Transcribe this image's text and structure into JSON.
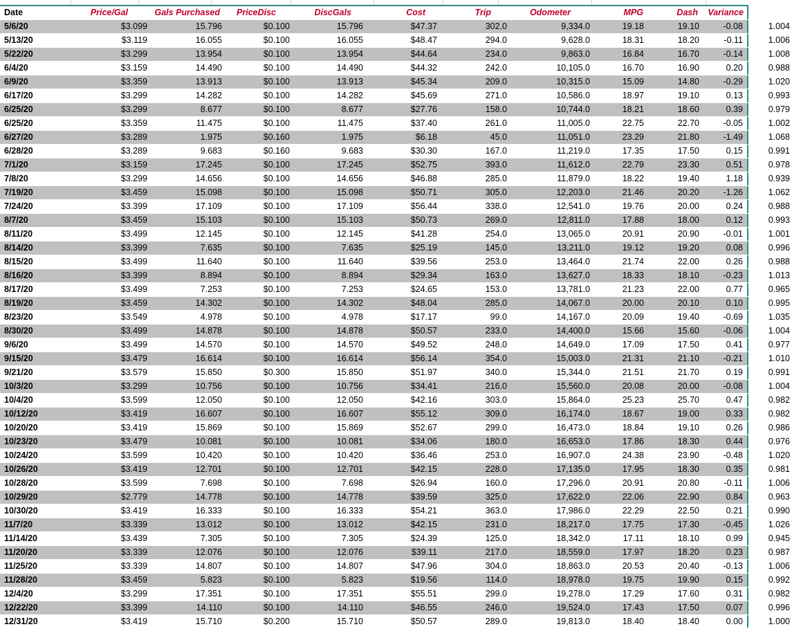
{
  "headers": {
    "date": "Date",
    "price": "Price/Gal",
    "gals": "Gals Purchased",
    "pricedisc": "PriceDisc",
    "discgals": "DiscGals",
    "cost": "Cost",
    "trip": "Trip",
    "odometer": "Odometer",
    "mpg": "MPG",
    "dash": "Dash",
    "variance": "Variance"
  },
  "rows": [
    [
      "5/6/20",
      "$3.099",
      "15.796",
      "$0.100",
      "15.796",
      "$47.37",
      "302.0",
      "9,334.0",
      "19.18",
      "19.10",
      "-0.08",
      "1.004"
    ],
    [
      "5/13/20",
      "$3.119",
      "16.055",
      "$0.100",
      "16.055",
      "$48.47",
      "294.0",
      "9,628.0",
      "18.31",
      "18.20",
      "-0.11",
      "1.006"
    ],
    [
      "5/22/20",
      "$3.299",
      "13.954",
      "$0.100",
      "13.954",
      "$44.64",
      "234.0",
      "9,863.0",
      "16.84",
      "16.70",
      "-0.14",
      "1.008"
    ],
    [
      "6/4/20",
      "$3.159",
      "14.490",
      "$0.100",
      "14.490",
      "$44.32",
      "242.0",
      "10,105.0",
      "16.70",
      "16.90",
      "0.20",
      "0.988"
    ],
    [
      "6/9/20",
      "$3.359",
      "13.913",
      "$0.100",
      "13.913",
      "$45.34",
      "209.0",
      "10,315.0",
      "15.09",
      "14.80",
      "-0.29",
      "1.020"
    ],
    [
      "6/17/20",
      "$3.299",
      "14.282",
      "$0.100",
      "14.282",
      "$45.69",
      "271.0",
      "10,586.0",
      "18.97",
      "19.10",
      "0.13",
      "0.993"
    ],
    [
      "6/25/20",
      "$3.299",
      "8.677",
      "$0.100",
      "8.677",
      "$27.76",
      "158.0",
      "10,744.0",
      "18.21",
      "18.60",
      "0.39",
      "0.979"
    ],
    [
      "6/25/20",
      "$3.359",
      "11.475",
      "$0.100",
      "11.475",
      "$37.40",
      "261.0",
      "11,005.0",
      "22.75",
      "22.70",
      "-0.05",
      "1.002"
    ],
    [
      "6/27/20",
      "$3.289",
      "1.975",
      "$0.160",
      "1.975",
      "$6.18",
      "45.0",
      "11,051.0",
      "23.29",
      "21.80",
      "-1.49",
      "1.068"
    ],
    [
      "6/28/20",
      "$3.289",
      "9.683",
      "$0.160",
      "9.683",
      "$30.30",
      "167.0",
      "11,219.0",
      "17.35",
      "17.50",
      "0.15",
      "0.991"
    ],
    [
      "7/1/20",
      "$3.159",
      "17.245",
      "$0.100",
      "17.245",
      "$52.75",
      "393.0",
      "11,612.0",
      "22.79",
      "23.30",
      "0.51",
      "0.978"
    ],
    [
      "7/8/20",
      "$3.299",
      "14.656",
      "$0.100",
      "14.656",
      "$46.88",
      "285.0",
      "11,879.0",
      "18.22",
      "19.40",
      "1.18",
      "0.939"
    ],
    [
      "7/19/20",
      "$3.459",
      "15.098",
      "$0.100",
      "15.098",
      "$50.71",
      "305.0",
      "12,203.0",
      "21.46",
      "20.20",
      "-1.26",
      "1.062"
    ],
    [
      "7/24/20",
      "$3.399",
      "17.109",
      "$0.100",
      "17.109",
      "$56.44",
      "338.0",
      "12,541.0",
      "19.76",
      "20.00",
      "0.24",
      "0.988"
    ],
    [
      "8/7/20",
      "$3.459",
      "15.103",
      "$0.100",
      "15.103",
      "$50.73",
      "269.0",
      "12,811.0",
      "17.88",
      "18.00",
      "0.12",
      "0.993"
    ],
    [
      "8/11/20",
      "$3.499",
      "12.145",
      "$0.100",
      "12.145",
      "$41.28",
      "254.0",
      "13,065.0",
      "20.91",
      "20.90",
      "-0.01",
      "1.001"
    ],
    [
      "8/14/20",
      "$3.399",
      "7.635",
      "$0.100",
      "7.635",
      "$25.19",
      "145.0",
      "13,211.0",
      "19.12",
      "19.20",
      "0.08",
      "0.996"
    ],
    [
      "8/15/20",
      "$3.499",
      "11.640",
      "$0.100",
      "11.640",
      "$39.56",
      "253.0",
      "13,464.0",
      "21.74",
      "22.00",
      "0.26",
      "0.988"
    ],
    [
      "8/16/20",
      "$3.399",
      "8.894",
      "$0.100",
      "8.894",
      "$29.34",
      "163.0",
      "13,627.0",
      "18.33",
      "18.10",
      "-0.23",
      "1.013"
    ],
    [
      "8/17/20",
      "$3.499",
      "7.253",
      "$0.100",
      "7.253",
      "$24.65",
      "153.0",
      "13,781.0",
      "21.23",
      "22.00",
      "0.77",
      "0.965"
    ],
    [
      "8/19/20",
      "$3.459",
      "14.302",
      "$0.100",
      "14.302",
      "$48.04",
      "285.0",
      "14,067.0",
      "20.00",
      "20.10",
      "0.10",
      "0.995"
    ],
    [
      "8/23/20",
      "$3.549",
      "4.978",
      "$0.100",
      "4.978",
      "$17.17",
      "99.0",
      "14,167.0",
      "20.09",
      "19.40",
      "-0.69",
      "1.035"
    ],
    [
      "8/30/20",
      "$3.499",
      "14.878",
      "$0.100",
      "14.878",
      "$50.57",
      "233.0",
      "14,400.0",
      "15.66",
      "15.60",
      "-0.06",
      "1.004"
    ],
    [
      "9/6/20",
      "$3.499",
      "14.570",
      "$0.100",
      "14.570",
      "$49.52",
      "248.0",
      "14,649.0",
      "17.09",
      "17.50",
      "0.41",
      "0.977"
    ],
    [
      "9/15/20",
      "$3.479",
      "16.614",
      "$0.100",
      "16.614",
      "$56.14",
      "354.0",
      "15,003.0",
      "21.31",
      "21.10",
      "-0.21",
      "1.010"
    ],
    [
      "9/21/20",
      "$3.579",
      "15.850",
      "$0.300",
      "15.850",
      "$51.97",
      "340.0",
      "15,344.0",
      "21.51",
      "21.70",
      "0.19",
      "0.991"
    ],
    [
      "10/3/20",
      "$3.299",
      "10.756",
      "$0.100",
      "10.756",
      "$34.41",
      "216.0",
      "15,560.0",
      "20.08",
      "20.00",
      "-0.08",
      "1.004"
    ],
    [
      "10/4/20",
      "$3.599",
      "12.050",
      "$0.100",
      "12.050",
      "$42.16",
      "303.0",
      "15,864.0",
      "25.23",
      "25.70",
      "0.47",
      "0.982"
    ],
    [
      "10/12/20",
      "$3.419",
      "16.607",
      "$0.100",
      "16.607",
      "$55.12",
      "309.0",
      "16,174.0",
      "18.67",
      "19.00",
      "0.33",
      "0.982"
    ],
    [
      "10/20/20",
      "$3.419",
      "15.869",
      "$0.100",
      "15.869",
      "$52.67",
      "299.0",
      "16,473.0",
      "18.84",
      "19.10",
      "0.26",
      "0.986"
    ],
    [
      "10/23/20",
      "$3.479",
      "10.081",
      "$0.100",
      "10.081",
      "$34.06",
      "180.0",
      "16,653.0",
      "17.86",
      "18.30",
      "0.44",
      "0.976"
    ],
    [
      "10/24/20",
      "$3.599",
      "10.420",
      "$0.100",
      "10.420",
      "$36.46",
      "253.0",
      "16,907.0",
      "24.38",
      "23.90",
      "-0.48",
      "1.020"
    ],
    [
      "10/26/20",
      "$3.419",
      "12.701",
      "$0.100",
      "12.701",
      "$42.15",
      "228.0",
      "17,135.0",
      "17.95",
      "18.30",
      "0.35",
      "0.981"
    ],
    [
      "10/28/20",
      "$3.599",
      "7.698",
      "$0.100",
      "7.698",
      "$26.94",
      "160.0",
      "17,296.0",
      "20.91",
      "20.80",
      "-0.11",
      "1.006"
    ],
    [
      "10/29/20",
      "$2.779",
      "14.778",
      "$0.100",
      "14.778",
      "$39.59",
      "325.0",
      "17,622.0",
      "22.06",
      "22.90",
      "0.84",
      "0.963"
    ],
    [
      "10/30/20",
      "$3.419",
      "16.333",
      "$0.100",
      "16.333",
      "$54.21",
      "363.0",
      "17,986.0",
      "22.29",
      "22.50",
      "0.21",
      "0.990"
    ],
    [
      "11/7/20",
      "$3.339",
      "13.012",
      "$0.100",
      "13.012",
      "$42.15",
      "231.0",
      "18,217.0",
      "17.75",
      "17.30",
      "-0.45",
      "1.026"
    ],
    [
      "11/14/20",
      "$3.439",
      "7.305",
      "$0.100",
      "7.305",
      "$24.39",
      "125.0",
      "18,342.0",
      "17.11",
      "18.10",
      "0.99",
      "0.945"
    ],
    [
      "11/20/20",
      "$3.339",
      "12.076",
      "$0.100",
      "12.076",
      "$39.11",
      "217.0",
      "18,559.0",
      "17.97",
      "18.20",
      "0.23",
      "0.987"
    ],
    [
      "11/25/20",
      "$3.339",
      "14.807",
      "$0.100",
      "14.807",
      "$47.96",
      "304.0",
      "18,863.0",
      "20.53",
      "20.40",
      "-0.13",
      "1.006"
    ],
    [
      "11/28/20",
      "$3.459",
      "5.823",
      "$0.100",
      "5.823",
      "$19.56",
      "114.0",
      "18,978.0",
      "19.75",
      "19.90",
      "0.15",
      "0.992"
    ],
    [
      "12/4/20",
      "$3.299",
      "17.351",
      "$0.100",
      "17.351",
      "$55.51",
      "299.0",
      "19,278.0",
      "17.29",
      "17.60",
      "0.31",
      "0.982"
    ],
    [
      "12/22/20",
      "$3.399",
      "14.110",
      "$0.100",
      "14.110",
      "$46.55",
      "246.0",
      "19,524.0",
      "17.43",
      "17.50",
      "0.07",
      "0.996"
    ],
    [
      "12/31/20",
      "$3.419",
      "15.710",
      "$0.200",
      "15.710",
      "$50.57",
      "289.0",
      "19,813.0",
      "18.40",
      "18.40",
      "0.00",
      "1.000"
    ]
  ],
  "colors": {
    "header_text": "#c0002a",
    "band_gray": "#c0c0c0",
    "border_teal": "#2a8b8b"
  }
}
